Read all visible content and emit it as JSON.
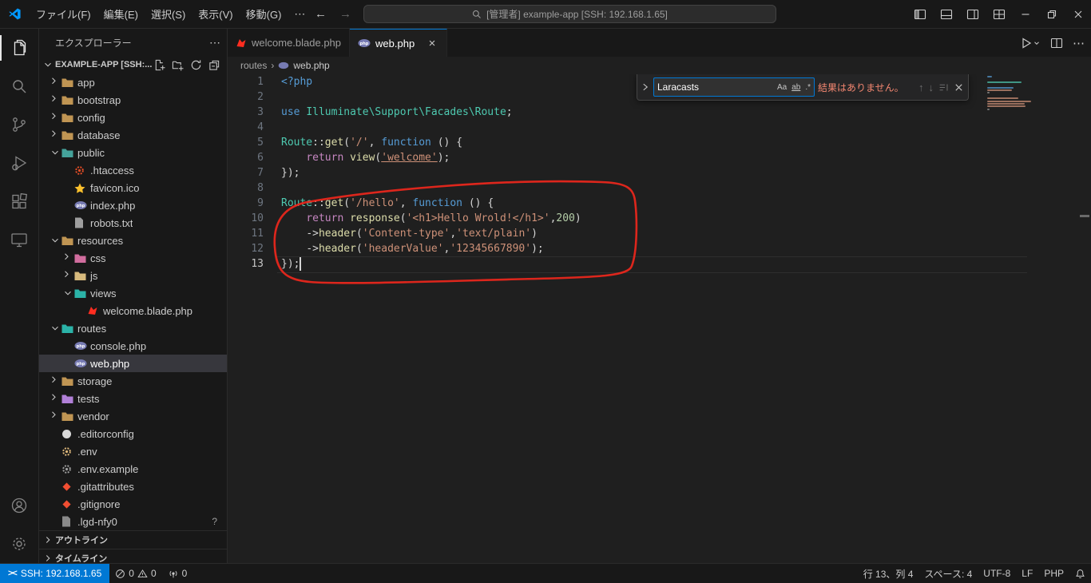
{
  "colors": {
    "accent": "#0078d4",
    "annotation_red": "#e8271c",
    "selection": "#37373d",
    "editor_bg": "#1f1f1f",
    "chrome_bg": "#181818"
  },
  "icons": {
    "more": "⋯",
    "back": "←",
    "forward": "→",
    "find_prev": "↑",
    "find_next": "↓"
  },
  "title_bar": {
    "menus": [
      "ファイル(F)",
      "編集(E)",
      "選択(S)",
      "表示(V)",
      "移動(G)"
    ],
    "command_center": "[管理者] example-app [SSH: 192.168.1.65]"
  },
  "explorer": {
    "title": "エクスプローラー",
    "section_title": "EXAMPLE-APP [SSH:...",
    "outline_label": "アウトライン",
    "timeline_label": "タイムライン",
    "items": [
      {
        "label": "app",
        "depth": 0,
        "icon": "folder",
        "arrow": "collapsed"
      },
      {
        "label": "bootstrap",
        "depth": 0,
        "icon": "folder",
        "arrow": "collapsed"
      },
      {
        "label": "config",
        "depth": 0,
        "icon": "folder",
        "arrow": "collapsed"
      },
      {
        "label": "database",
        "depth": 0,
        "icon": "folder",
        "arrow": "collapsed"
      },
      {
        "label": "public",
        "depth": 0,
        "icon": "folder-public",
        "arrow": "expanded"
      },
      {
        "label": ".htaccess",
        "depth": 1,
        "icon": "htaccess"
      },
      {
        "label": "favicon.ico",
        "depth": 1,
        "icon": "favicon"
      },
      {
        "label": "index.php",
        "depth": 1,
        "icon": "php"
      },
      {
        "label": "robots.txt",
        "depth": 1,
        "icon": "txt"
      },
      {
        "label": "resources",
        "depth": 0,
        "icon": "folder",
        "arrow": "expanded"
      },
      {
        "label": "css",
        "depth": 1,
        "icon": "folder-css",
        "arrow": "collapsed"
      },
      {
        "label": "js",
        "depth": 1,
        "icon": "folder-js",
        "arrow": "collapsed"
      },
      {
        "label": "views",
        "depth": 1,
        "icon": "folder-views",
        "arrow": "expanded"
      },
      {
        "label": "welcome.blade.php",
        "depth": 2,
        "icon": "blade"
      },
      {
        "label": "routes",
        "depth": 0,
        "icon": "folder-routes",
        "arrow": "expanded"
      },
      {
        "label": "console.php",
        "depth": 1,
        "icon": "php"
      },
      {
        "label": "web.php",
        "depth": 1,
        "icon": "php",
        "selected": true
      },
      {
        "label": "storage",
        "depth": 0,
        "icon": "folder",
        "arrow": "collapsed"
      },
      {
        "label": "tests",
        "depth": 0,
        "icon": "folder-tests",
        "arrow": "collapsed"
      },
      {
        "label": "vendor",
        "depth": 0,
        "icon": "folder",
        "arrow": "collapsed"
      },
      {
        "label": ".editorconfig",
        "depth": 0,
        "icon": "editorconfig"
      },
      {
        "label": ".env",
        "depth": 0,
        "icon": "env"
      },
      {
        "label": ".env.example",
        "depth": 0,
        "icon": "env-example"
      },
      {
        "label": ".gitattributes",
        "depth": 0,
        "icon": "git"
      },
      {
        "label": ".gitignore",
        "depth": 0,
        "icon": "git"
      },
      {
        "label": ".lgd-nfy0",
        "depth": 0,
        "icon": "file",
        "badge": "?"
      }
    ]
  },
  "tabs": [
    {
      "label": "welcome.blade.php",
      "icon": "blade",
      "active": false
    },
    {
      "label": "web.php",
      "icon": "php",
      "active": true
    }
  ],
  "breadcrumbs": {
    "folder": "routes",
    "separator": "›",
    "file": "web.php"
  },
  "find_widget": {
    "query": "Laracasts",
    "toggles": [
      "Aa",
      "ab",
      ".*"
    ],
    "message": "結果はありません。"
  },
  "editor": {
    "active_line": 13,
    "lines": [
      {
        "n": 1,
        "tokens": [
          [
            "<?php",
            "kw"
          ]
        ]
      },
      {
        "n": 2,
        "tokens": []
      },
      {
        "n": 3,
        "tokens": [
          [
            "use ",
            "kw"
          ],
          [
            "Illuminate\\Support\\Facades\\Route",
            "cls"
          ],
          [
            ";",
            "pun"
          ]
        ]
      },
      {
        "n": 4,
        "tokens": []
      },
      {
        "n": 5,
        "tokens": [
          [
            "Route",
            "cls"
          ],
          [
            "::",
            "pun"
          ],
          [
            "get",
            "fn"
          ],
          [
            "(",
            "pun"
          ],
          [
            "'/'",
            "str"
          ],
          [
            ", ",
            "pun"
          ],
          [
            "function",
            "kw"
          ],
          [
            " () ",
            "pun"
          ],
          [
            "{",
            "pun"
          ]
        ]
      },
      {
        "n": 6,
        "tokens": [
          [
            "    ",
            "pun"
          ],
          [
            "return",
            "ctl"
          ],
          [
            " ",
            "pun"
          ],
          [
            "view",
            "fn"
          ],
          [
            "(",
            "pun"
          ],
          [
            "'welcome'",
            "str-u"
          ],
          [
            ")",
            "pun"
          ],
          [
            ";",
            "pun"
          ]
        ]
      },
      {
        "n": 7,
        "tokens": [
          [
            "});",
            "pun"
          ]
        ]
      },
      {
        "n": 8,
        "tokens": []
      },
      {
        "n": 9,
        "tokens": [
          [
            "Route",
            "cls"
          ],
          [
            "::",
            "pun"
          ],
          [
            "get",
            "fn"
          ],
          [
            "(",
            "pun"
          ],
          [
            "'/hello'",
            "str"
          ],
          [
            ", ",
            "pun"
          ],
          [
            "function",
            "kw"
          ],
          [
            " () ",
            "pun"
          ],
          [
            "{",
            "pun"
          ]
        ]
      },
      {
        "n": 10,
        "tokens": [
          [
            "    ",
            "pun"
          ],
          [
            "return",
            "ctl"
          ],
          [
            " ",
            "pun"
          ],
          [
            "response",
            "fn"
          ],
          [
            "(",
            "pun"
          ],
          [
            "'<h1>Hello Wrold!</h1>'",
            "str"
          ],
          [
            ",",
            "pun"
          ],
          [
            "200",
            "num"
          ],
          [
            ")",
            "pun"
          ]
        ]
      },
      {
        "n": 11,
        "tokens": [
          [
            "    ",
            "pun"
          ],
          [
            "->",
            "pun"
          ],
          [
            "header",
            "fn"
          ],
          [
            "(",
            "pun"
          ],
          [
            "'Content-type'",
            "str"
          ],
          [
            ",",
            "pun"
          ],
          [
            "'text/plain'",
            "str"
          ],
          [
            ")",
            "pun"
          ]
        ]
      },
      {
        "n": 12,
        "tokens": [
          [
            "    ",
            "pun"
          ],
          [
            "->",
            "pun"
          ],
          [
            "header",
            "fn"
          ],
          [
            "(",
            "pun"
          ],
          [
            "'headerValue'",
            "str"
          ],
          [
            ",",
            "pun"
          ],
          [
            "'12345667890'",
            "str"
          ],
          [
            ")",
            "pun"
          ],
          [
            ";",
            "pun"
          ]
        ]
      },
      {
        "n": 13,
        "tokens": [
          [
            "});",
            "pun"
          ]
        ],
        "cursor": true
      }
    ]
  },
  "status_bar": {
    "remote": "SSH: 192.168.1.65",
    "errors": "0",
    "warnings": "0",
    "ports": "0",
    "line_col": "行 13、列 4",
    "indent": "スペース: 4",
    "encoding": "UTF-8",
    "eol": "LF",
    "language": "PHP"
  }
}
